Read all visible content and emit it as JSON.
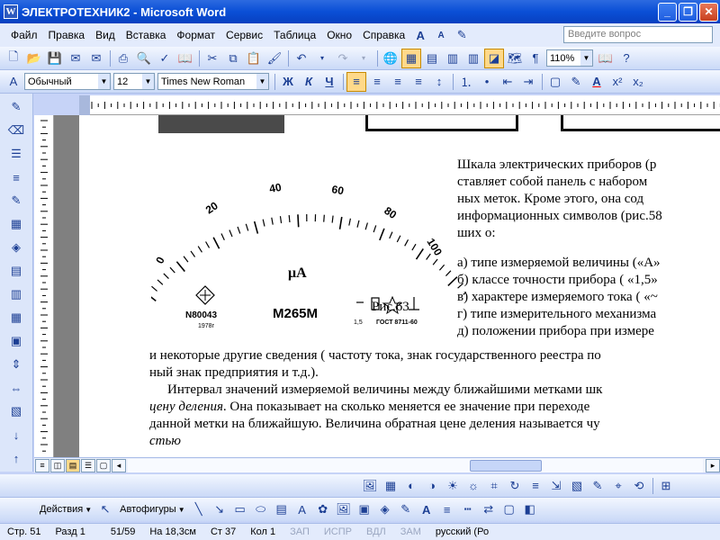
{
  "window": {
    "title": "ЭЛЕКТРОТЕХНИК2 - Microsoft Word",
    "app_icon": "W"
  },
  "menu": {
    "items": [
      "Файл",
      "Правка",
      "Вид",
      "Вставка",
      "Формат",
      "Сервис",
      "Таблица",
      "Окно",
      "Справка"
    ],
    "ask_placeholder": "Введите вопрос"
  },
  "standard_toolbar": {
    "zoom": "110%"
  },
  "formatting_toolbar": {
    "style": "Обычный",
    "size": "12",
    "font": "Times New Roman"
  },
  "figure": {
    "scale_labels": [
      "0",
      "20",
      "40",
      "60",
      "80",
      "100"
    ],
    "unit": "μA",
    "serial": "N80043",
    "year": "1978г",
    "model": "M265M",
    "class": "1,5",
    "gost": "ГОСТ 8711-60",
    "caption": "Рис.63"
  },
  "right_text": {
    "lines": [
      "Шкала электрических приборов (р",
      "ставляет собой панель с набором",
      "ных меток. Кроме этого, она сод",
      "информационных символов (рис.58",
      "ших о:"
    ],
    "list": [
      "а) типе измеряемой величины («A»",
      "б) классе точности прибора ( «1,5»",
      "в) характере измеряемого тока ( «~",
      "г) типе измерительного механизма",
      "д) положении прибора при измере"
    ]
  },
  "body_text": {
    "line1": "и некоторые другие сведения ( частоту тока, знак государственного реестра по",
    "line2": "ный знак предприятия и т.д.).",
    "line3": "Интервал значений измеряемой величины между ближайшими метками шк",
    "line4_italic": "цену деления",
    "line4_rest": ". Она показывает на сколько меняется ее значение при переходе",
    "line5": "данной метки на ближайшую. Величина обратная цене деления называется чу",
    "line6_italic": "стью"
  },
  "drawing_toolbar": {
    "actions": "Действия",
    "autoshapes": "Автофигуры"
  },
  "status": {
    "page": "Стр. 51",
    "section": "Разд 1",
    "pages": "51/59",
    "position": "На 18,3см",
    "line": "Ст 37",
    "col": "Кол 1",
    "rec": "ЗАП",
    "trk": "ИСПР",
    "ext": "ВДЛ",
    "ovr": "ЗАМ",
    "lang": "русский (Ро"
  }
}
